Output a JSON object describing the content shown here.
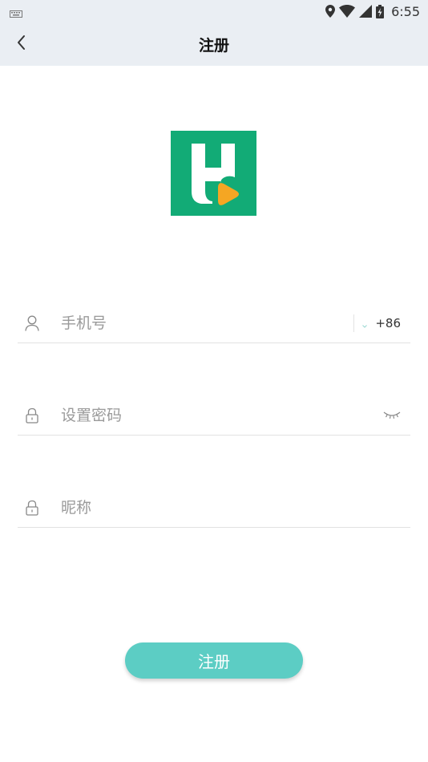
{
  "status_bar": {
    "time": "6:55",
    "icons": [
      "keyboard-icon",
      "location-icon",
      "wifi-icon",
      "signal-icon",
      "battery-charging-icon"
    ]
  },
  "app_bar": {
    "title": "注册",
    "back_icon": "chevron-left-icon"
  },
  "logo": {
    "icon": "app-logo-h-play",
    "colors": {
      "background": "#12ab76",
      "letter": "#ffffff",
      "play": "#f5a623"
    }
  },
  "form": {
    "phone": {
      "placeholder": "手机号",
      "value": "",
      "icon": "user-icon",
      "country_code": "+86"
    },
    "password": {
      "placeholder": "设置密码",
      "value": "",
      "icon": "lock-icon",
      "toggle_icon": "eye-closed-icon"
    },
    "nickname": {
      "placeholder": "昵称",
      "value": "",
      "icon": "lock-icon"
    }
  },
  "submit": {
    "label": "注册",
    "color": "#5ccdc4"
  }
}
